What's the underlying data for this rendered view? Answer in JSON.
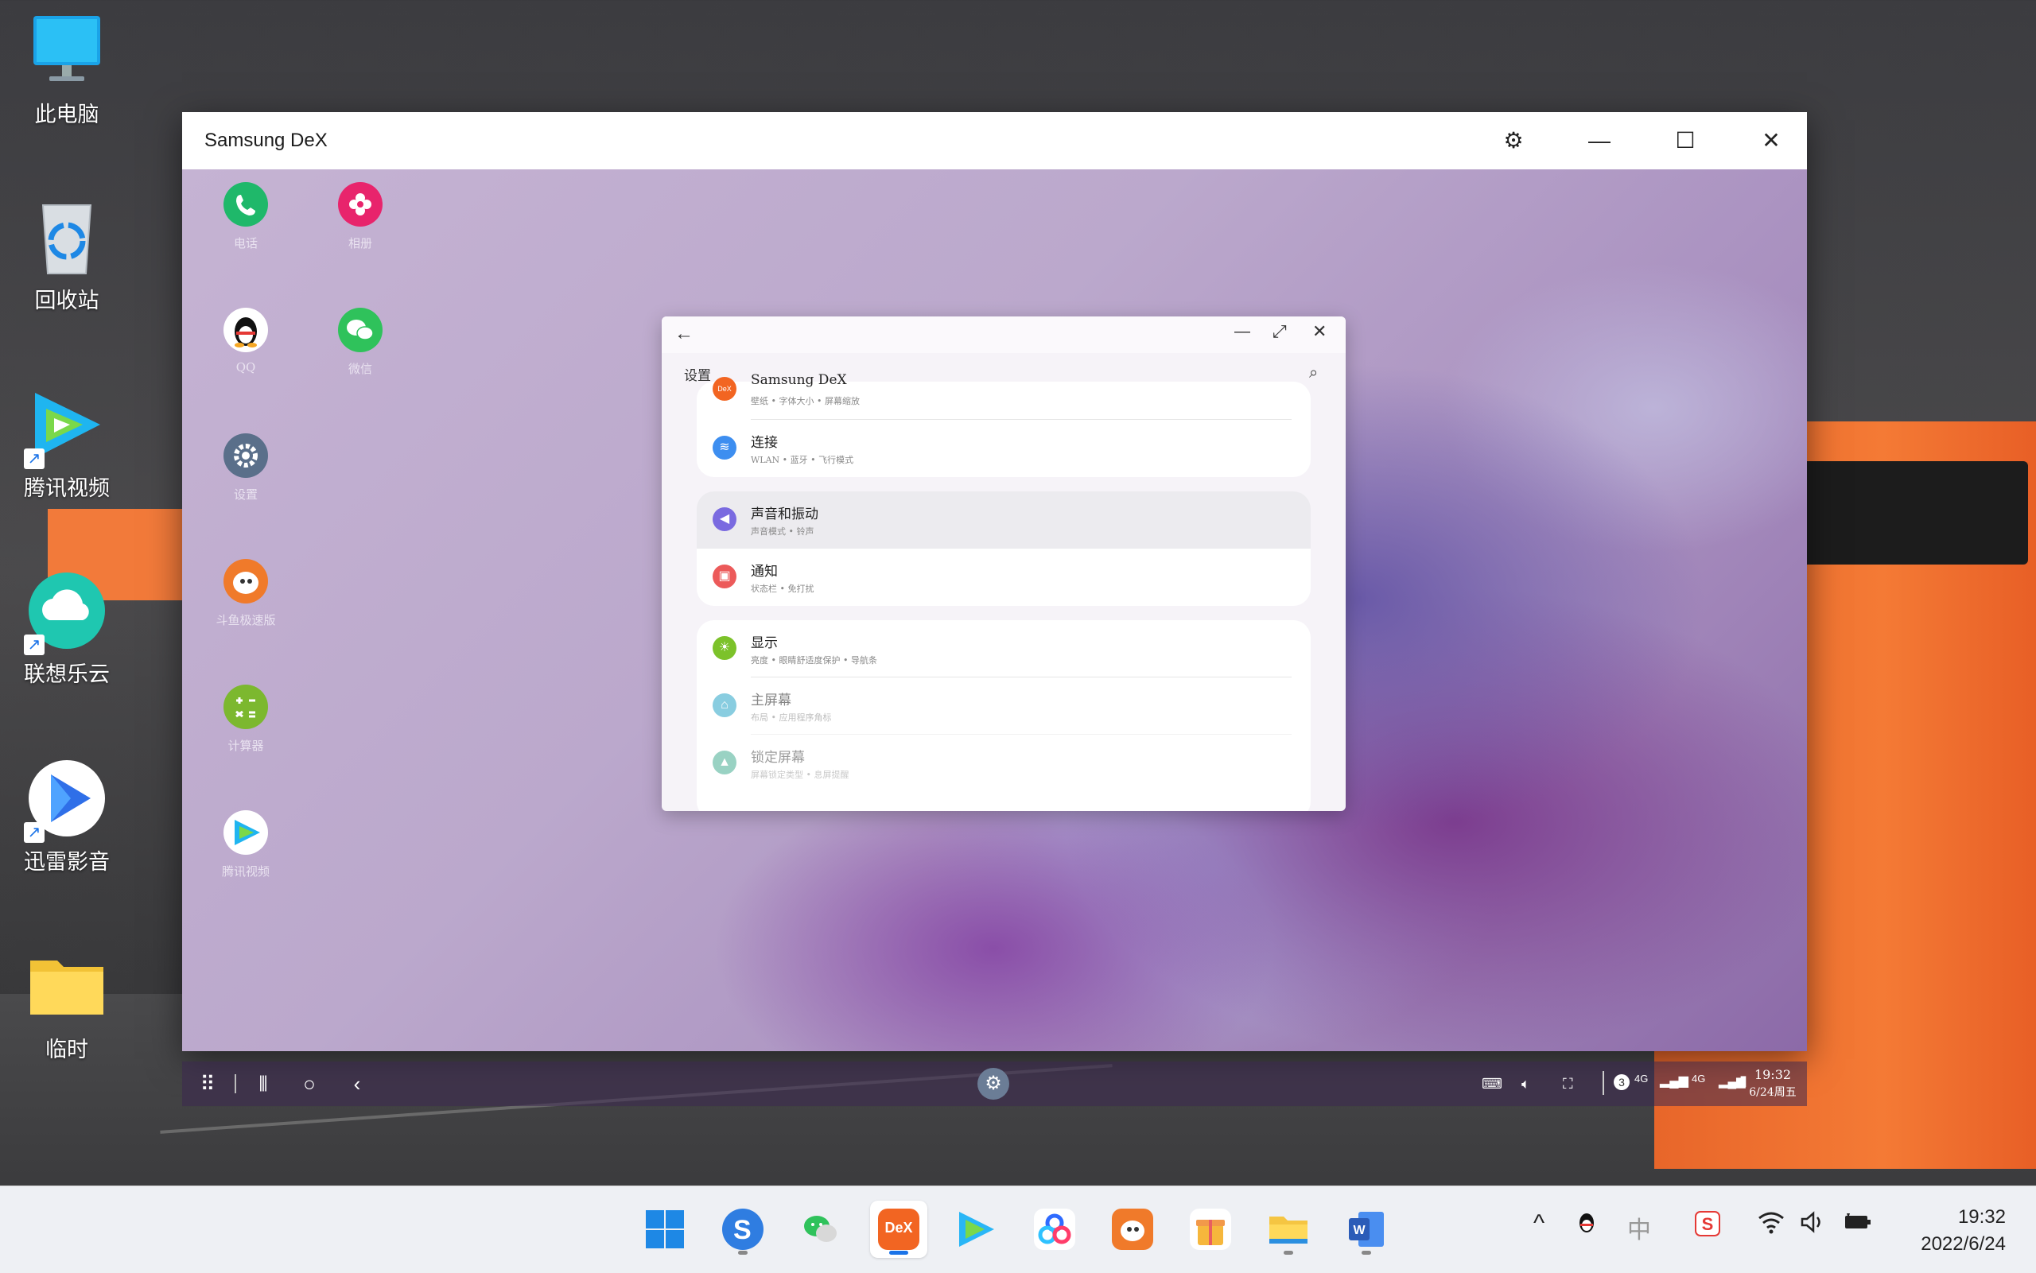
{
  "desktop": {
    "icons": [
      {
        "label": "此电脑",
        "icon": "computer-icon"
      },
      {
        "label": "回收站",
        "icon": "recycle-bin-icon"
      },
      {
        "label": "腾讯视频",
        "icon": "tencent-video-icon"
      },
      {
        "label": "联想乐云",
        "icon": "lenovo-cloud-icon"
      },
      {
        "label": "迅雷影音",
        "icon": "xunlei-player-icon"
      },
      {
        "label": "临时",
        "icon": "folder-icon"
      }
    ]
  },
  "dex_window": {
    "title": "Samsung DeX",
    "buttons": {
      "settings": "⚙",
      "minimize": "—",
      "maximize": "☐",
      "close": "✕"
    }
  },
  "dex_apps": [
    {
      "label": "电话",
      "icon": "phone-icon",
      "color": "#1fb86a"
    },
    {
      "label": "相册",
      "icon": "gallery-icon",
      "color": "#e8246c"
    },
    {
      "label": "QQ",
      "icon": "qq-icon",
      "color": "#ffffff"
    },
    {
      "label": "微信",
      "icon": "wechat-icon",
      "color": "#2fc25b"
    },
    {
      "label": "设置",
      "icon": "settings-icon",
      "color": "#5a6f8a"
    },
    {
      "label": "斗鱼极速版",
      "icon": "douyu-icon",
      "color": "#f07a2a"
    },
    {
      "label": "计算器",
      "icon": "calculator-icon",
      "color": "#7cb82f"
    },
    {
      "label": "腾讯视频",
      "icon": "tencent-video-icon",
      "color": "#ffffff"
    }
  ],
  "settings_window": {
    "title": "设置",
    "top_item": {
      "title": "Samsung DeX",
      "subtitle": "壁纸  •  字体大小  •  屏幕缩放"
    },
    "groups": [
      [
        {
          "title": "连接",
          "subtitle": "WLAN  •  蓝牙  •  飞行模式",
          "icon": "wifi-icon",
          "color": "#3d8ef0"
        }
      ],
      [
        {
          "title": "声音和振动",
          "subtitle": "声音模式  •  铃声",
          "icon": "volume-icon",
          "color": "#7a6ae0"
        },
        {
          "title": "通知",
          "subtitle": "状态栏  •  免打扰",
          "icon": "notification-icon",
          "color": "#ec5a5a"
        }
      ],
      [
        {
          "title": "显示",
          "subtitle": "亮度  •  眼睛舒适度保护  •  导航条",
          "icon": "display-icon",
          "color": "#7cc22a"
        },
        {
          "title": "主屏幕",
          "subtitle": "布局  •  应用程序角标",
          "icon": "home-icon",
          "color": "#2aa6c8"
        },
        {
          "title": "锁定屏幕",
          "subtitle": "屏幕锁定类型  •  息屏提醒",
          "icon": "lock-icon",
          "color": "#1f9c7c"
        }
      ]
    ]
  },
  "dex_taskbar": {
    "time": "19:32",
    "date": "6/24周五",
    "network_a": "4G",
    "network_b": "4G",
    "badge": "3"
  },
  "taskbar": {
    "apps": [
      {
        "icon": "windows-start-icon",
        "color": "#1e88e5"
      },
      {
        "icon": "sogou-browser-icon",
        "color": "#2f7de1"
      },
      {
        "icon": "wechat-icon",
        "color": "#2fc25b"
      },
      {
        "icon": "dex-icon",
        "color": "#f26522",
        "label": "DeX"
      },
      {
        "icon": "tencent-video-icon",
        "color": "#29b6f6"
      },
      {
        "icon": "baidu-netdisk-icon",
        "color": "#2f6bff"
      },
      {
        "icon": "douyu-icon",
        "color": "#f07a2a"
      },
      {
        "icon": "gift-icon",
        "color": "#f6b73c"
      },
      {
        "icon": "file-explorer-icon",
        "color": "#f5c542"
      },
      {
        "icon": "word-icon",
        "color": "#2b5cb8"
      }
    ],
    "ime": "中",
    "time": "19:32",
    "date": "2022/6/24"
  }
}
